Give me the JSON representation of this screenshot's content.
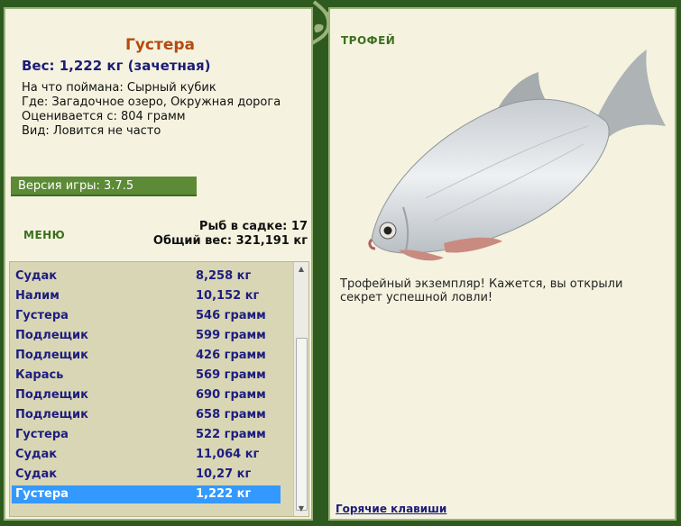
{
  "fish": {
    "name": "Густера",
    "weight_line": "Вес: 1,222 кг (зачетная)",
    "bait_line": "На что поймана: Сырный кубик",
    "place_line": "Где: Загадочное озеро, Окружная дорога",
    "value_line": "Оценивается с: 804 грамм",
    "kind_line": "Вид: Ловится не часто"
  },
  "version_label": "Версия игры: 3.7.5",
  "menu_label": "МЕНЮ",
  "totals": {
    "count_line": "Рыб в садке: 17",
    "weight_line": "Общий вес: 321,191 кг"
  },
  "catch_list": [
    {
      "name": "Судак",
      "weight": "8,258 кг"
    },
    {
      "name": "Налим",
      "weight": "10,152 кг"
    },
    {
      "name": "Густера",
      "weight": "546 грамм"
    },
    {
      "name": "Подлещик",
      "weight": "599 грамм"
    },
    {
      "name": "Подлещик",
      "weight": "426 грамм"
    },
    {
      "name": "Карась",
      "weight": "569 грамм"
    },
    {
      "name": "Подлещик",
      "weight": "690 грамм"
    },
    {
      "name": "Подлещик",
      "weight": "658 грамм"
    },
    {
      "name": "Густера",
      "weight": "522 грамм"
    },
    {
      "name": "Судак",
      "weight": "11,064 кг"
    },
    {
      "name": "Судак",
      "weight": "10,27 кг"
    },
    {
      "name": "Густера",
      "weight": "1,222 кг"
    }
  ],
  "selected_index": 11,
  "trophy": {
    "label": "ТРОФЕЙ",
    "message": "Трофейный экземпляр! Кажется, вы открыли секрет успешной ловли!"
  },
  "hotkeys_label": "Горячие клавиши",
  "colors": {
    "background": "#2f5a1f",
    "panel": "#f5f3df",
    "accent_green": "#5c8a36",
    "fish_name": "#b64a10",
    "list_text": "#1d1d80",
    "selection": "#3399ff"
  },
  "icons": {
    "fish_picture": "bream-fish-image",
    "vine": "leaf-vine-ornament",
    "scroll_up": "triangle-up-icon",
    "scroll_down": "triangle-down-icon"
  }
}
